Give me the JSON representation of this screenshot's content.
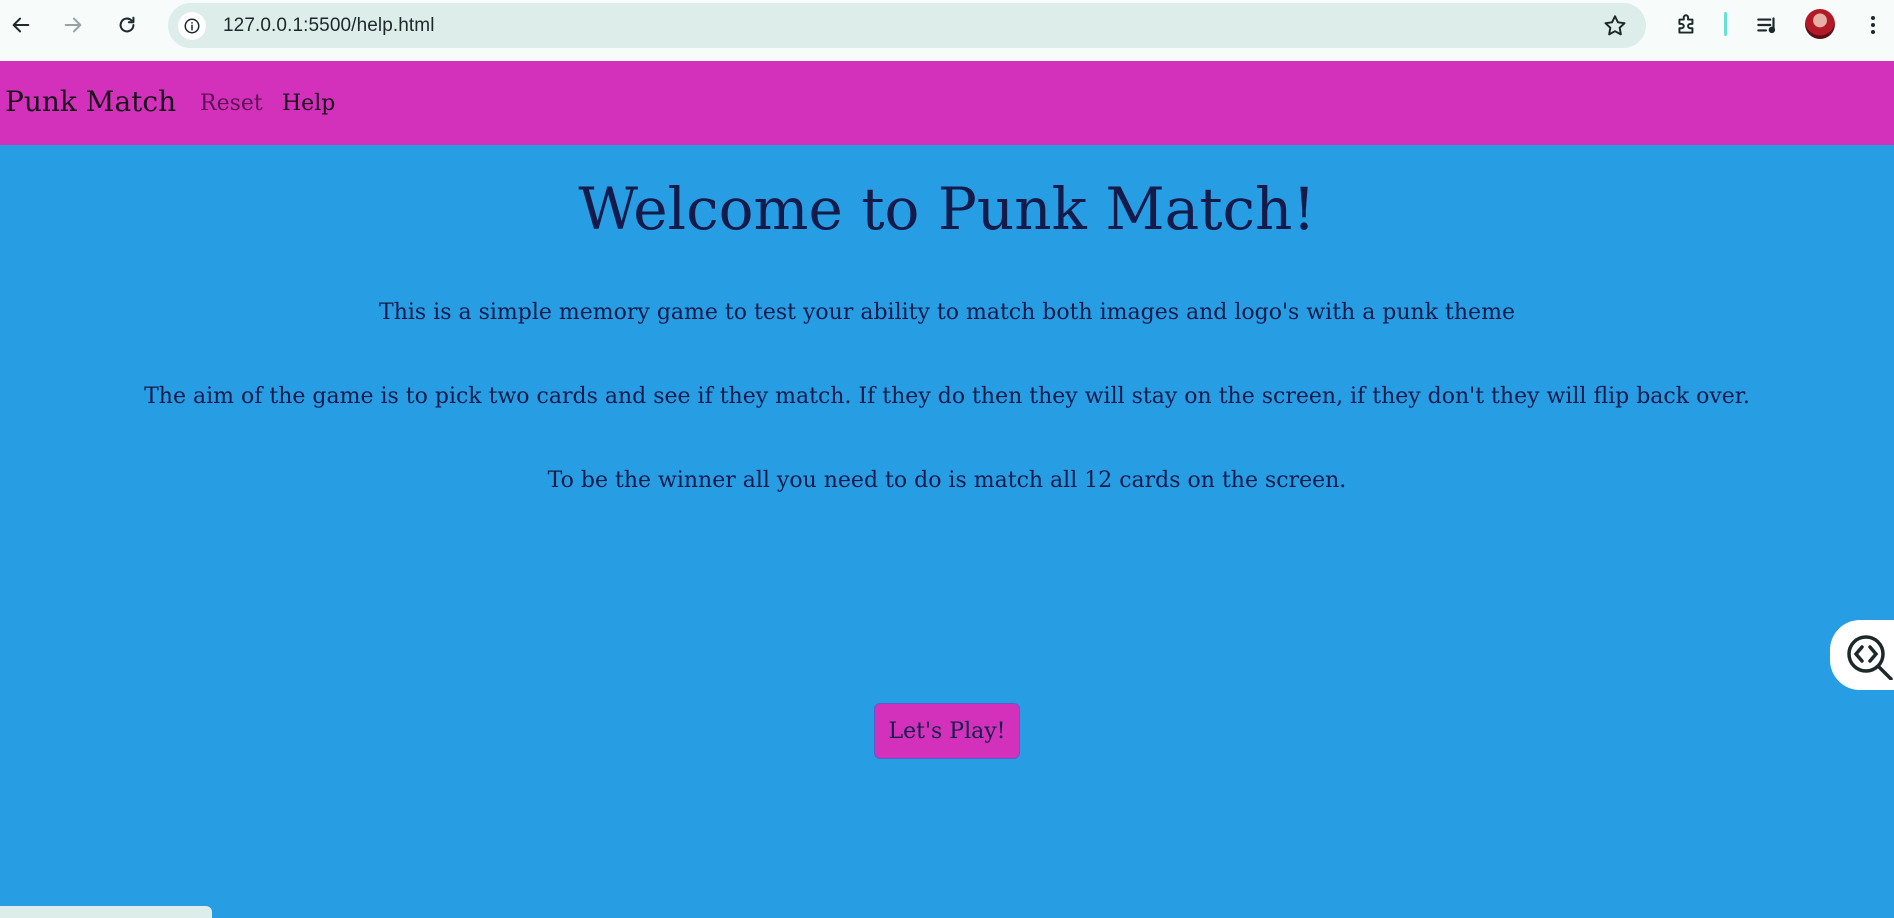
{
  "browser": {
    "url": "127.0.0.1:5500/help.html"
  },
  "navbar": {
    "brand": "Punk Match",
    "links": [
      {
        "label": "Reset"
      },
      {
        "label": "Help"
      }
    ]
  },
  "main": {
    "title": "Welcome to Punk Match!",
    "paragraphs": [
      "This is a simple memory game to test your ability to match both images and logo's with a punk theme",
      "The aim of the game is to pick two cards and see if they match. If they do then they will stay on the screen, if they don't they will flip back over.",
      "To be the winner all you need to do is match all 12 cards on the screen."
    ],
    "play_button": "Let's Play!"
  },
  "colors": {
    "navbar": "#d331bc",
    "background": "#279de3",
    "text": "#141a4a",
    "button": "#d331bc"
  },
  "icons": [
    "back-arrow-icon",
    "forward-arrow-icon",
    "reload-icon",
    "site-info-icon",
    "star-icon",
    "extensions-icon",
    "media-control-icon",
    "profile-avatar",
    "more-menu-icon",
    "inspect-code-icon"
  ]
}
